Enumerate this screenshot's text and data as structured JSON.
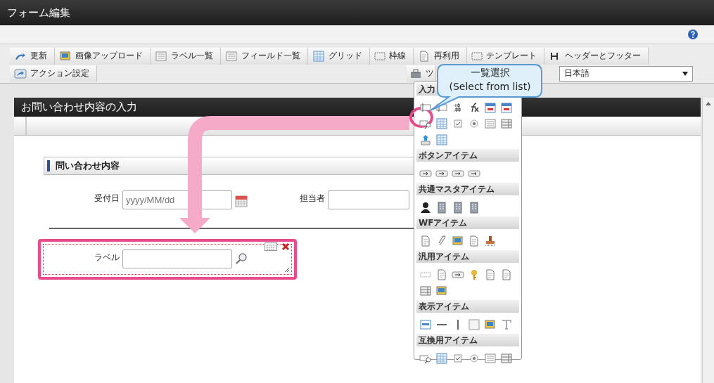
{
  "window": {
    "title": "フォーム編集"
  },
  "toolbar": {
    "row_1": [
      {
        "label": "更新"
      },
      {
        "label": "画像アップロード"
      },
      {
        "label": "ラベル一覧"
      },
      {
        "label": "フィールド一覧"
      },
      {
        "label": "グリッド"
      },
      {
        "label": "枠線"
      },
      {
        "label": "再利用"
      },
      {
        "label": "テンプレート"
      },
      {
        "label": "ヘッダーとフッター"
      }
    ],
    "row_2": [
      {
        "label": "アクション設定"
      },
      {
        "label": "ツ"
      }
    ],
    "language": {
      "value": "日本語"
    }
  },
  "form": {
    "title": "お問い合わせ内容の入力",
    "section": "問い合わせ内容",
    "fields": [
      {
        "label": "受付日",
        "placeholder": "yyyy/MM/dd",
        "kind": "date"
      },
      {
        "label": "担当者",
        "kind": "text"
      }
    ],
    "selected_item": {
      "label": "ラベル",
      "kind": "search"
    }
  },
  "palette": {
    "header": "入力",
    "groups": [
      {
        "title": "ボタンアイテム"
      },
      {
        "title": "共通マスタアイテム"
      },
      {
        "title": "WFアイテム"
      },
      {
        "title": "汎用アイテム"
      },
      {
        "title": "表示アイテム"
      },
      {
        "title": "互換用アイテム"
      }
    ]
  },
  "callout": {
    "title": "一覧選択",
    "subtitle": "(Select from list)"
  }
}
